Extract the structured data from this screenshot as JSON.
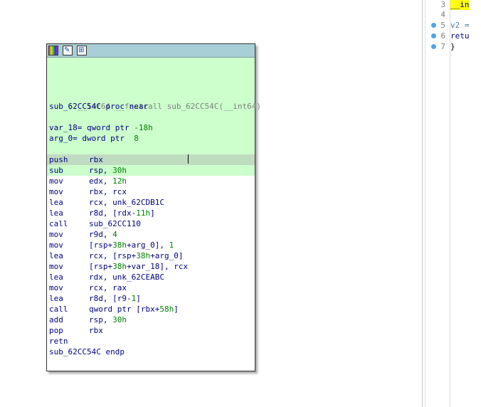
{
  "pseudocode": {
    "lines": [
      {
        "num": "3",
        "text": "__in",
        "style": "hl",
        "dot": false
      },
      {
        "num": "4",
        "text": "",
        "style": "",
        "dot": false
      },
      {
        "num": "5",
        "text": "v2 =",
        "style": "var",
        "dot": true
      },
      {
        "num": "6",
        "text": "retu",
        "style": "kw",
        "dot": true
      },
      {
        "num": "7",
        "text": "}",
        "style": "br",
        "dot": true
      }
    ]
  },
  "node": {
    "title_icons": [
      "color-palette-icon",
      "edit-graph-icon",
      "zoom-graph-icon"
    ],
    "header": {
      "comment": "; __int64 __fastcall sub_62CC54C(__int64)",
      "proc": "sub_62CC54C proc near",
      "var1_name": "var_18",
      "var1_decl": "= qword ptr ",
      "var1_val": "-18h",
      "var2_name": "arg_0",
      "var2_decl": "= dword ptr  ",
      "var2_val": "8"
    },
    "instructions": [
      {
        "mn": "push",
        "ops": "rbx"
      },
      {
        "mn": "sub",
        "ops": "rsp, 30h"
      },
      {
        "mn": "mov",
        "ops": "edx, 12h"
      },
      {
        "mn": "mov",
        "ops": "rbx, rcx"
      },
      {
        "mn": "lea",
        "ops": "rcx, unk_62CDB1C"
      },
      {
        "mn": "lea",
        "ops": "r8d, [rdx-11h]"
      },
      {
        "mn": "call",
        "ops": "sub_62CC110"
      },
      {
        "mn": "mov",
        "ops": "r9d, 4"
      },
      {
        "mn": "mov",
        "ops": "[rsp+38h+arg_0], 1"
      },
      {
        "mn": "lea",
        "ops": "rcx, [rsp+38h+arg_0]"
      },
      {
        "mn": "mov",
        "ops": "[rsp+38h+var_18], rcx"
      },
      {
        "mn": "lea",
        "ops": "rdx, unk_62CEABC"
      },
      {
        "mn": "mov",
        "ops": "rcx, rax"
      },
      {
        "mn": "lea",
        "ops": "r8d, [r9-1]"
      },
      {
        "mn": "call",
        "ops": "qword ptr [rbx+58h]"
      },
      {
        "mn": "add",
        "ops": "rsp, 30h"
      },
      {
        "mn": "pop",
        "ops": "rbx"
      },
      {
        "mn": "retn",
        "ops": ""
      }
    ],
    "endp": "sub_62CC54C endp",
    "selected_row": 0,
    "colors": {
      "title_bar": "#a9cfd6",
      "block_bg": "#ccffcc",
      "selected": "#c0dcc0",
      "text": "#000080",
      "number": "#008000"
    }
  }
}
